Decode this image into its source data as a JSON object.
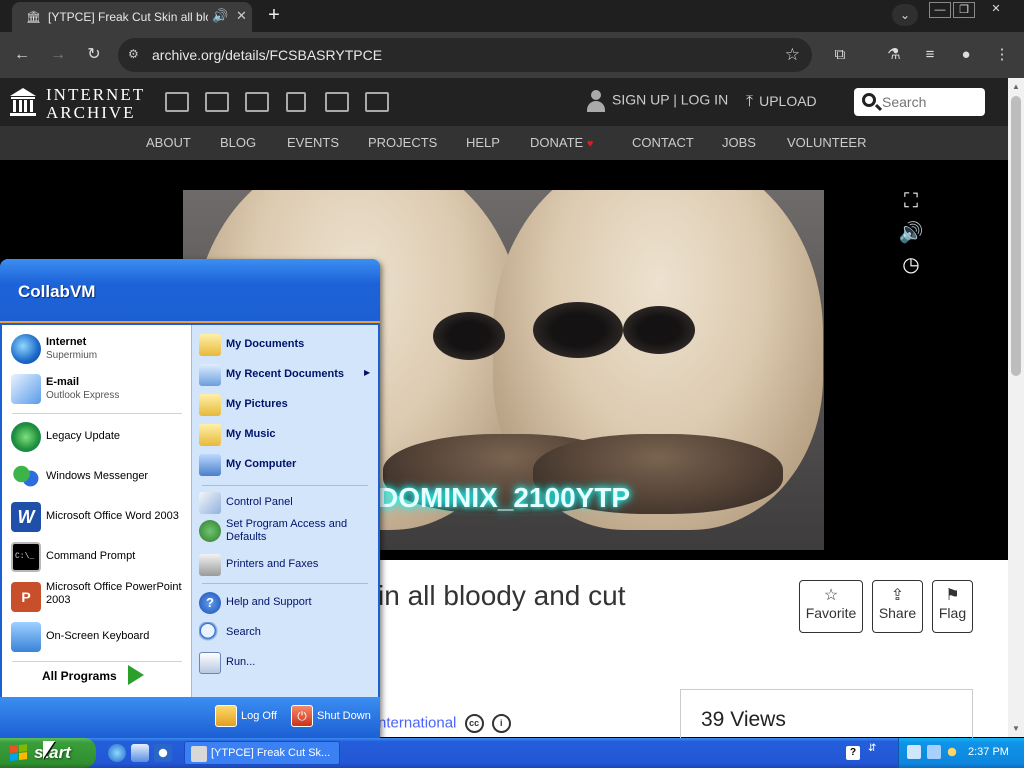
{
  "browser": {
    "tab_title": "[YTPCE] Freak Cut Skin all blo",
    "url": "archive.org/details/FCSBASRYTPCE",
    "new_tab_label": "+",
    "window_controls": [
      "—",
      "❐",
      "✕"
    ]
  },
  "ia": {
    "logo_line1": "INTERNET",
    "logo_line2": "ARCHIVE",
    "signup_label": "SIGN UP | LOG IN",
    "upload_label": "UPLOAD",
    "search_placeholder": "Search",
    "nav": [
      "ABOUT",
      "BLOG",
      "EVENTS",
      "PROJECTS",
      "HELP",
      "DONATE",
      "CONTACT",
      "JOBS",
      "VOLUNTEER"
    ],
    "video_watermark": "DOMINIX_2100YTP",
    "title_partial": "in all bloody and cut",
    "actions": {
      "favorite": "Favorite",
      "share": "Share",
      "flag": "Flag"
    },
    "license_partial": "nternational",
    "views": "39 Views"
  },
  "startmenu": {
    "user": "CollabVM",
    "left_items": [
      {
        "title": "Internet",
        "subtitle": "Supermium"
      },
      {
        "title": "E-mail",
        "subtitle": "Outlook Express"
      },
      {
        "title": "Legacy Update"
      },
      {
        "title": "Windows Messenger"
      },
      {
        "title": "Microsoft Office Word 2003"
      },
      {
        "title": "Command Prompt"
      },
      {
        "title": "Microsoft Office PowerPoint 2003"
      },
      {
        "title": "On-Screen Keyboard"
      }
    ],
    "all_programs": "All Programs",
    "right_items": [
      "My Documents",
      "My Recent Documents",
      "My Pictures",
      "My Music",
      "My Computer",
      "Control Panel",
      "Set Program Access and Defaults",
      "Printers and Faxes",
      "Help and Support",
      "Search",
      "Run..."
    ],
    "log_off": "Log Off",
    "shut_down": "Shut Down"
  },
  "taskbar": {
    "start_label": "start",
    "task_item": "[YTPCE] Freak Cut Sk...",
    "clock": "2:37 PM"
  },
  "colors": {
    "xp_blue": "#245edb",
    "start_green": "#3b9d3b",
    "ia_header": "#222222",
    "donate_heart": "#e21b1b",
    "watermark_glow": "#17f6f6"
  }
}
